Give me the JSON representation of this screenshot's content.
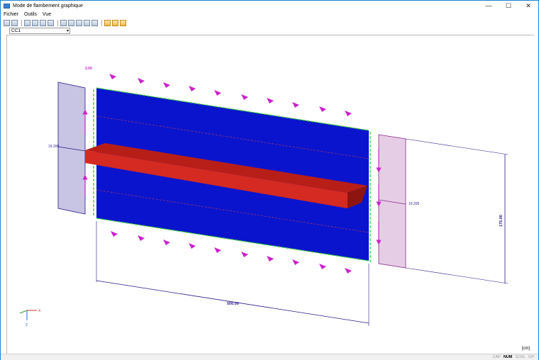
{
  "window": {
    "title": "Mode de flambement graphique",
    "buttons": {
      "minimize": "—",
      "maximize": "☐",
      "close": "✕"
    }
  },
  "menu": [
    "Fichier",
    "Outils",
    "Vue"
  ],
  "toolbar": {
    "count_left": 3,
    "count_mid": 5,
    "count_right": 2
  },
  "load_case": {
    "selected": "CC1"
  },
  "drawing": {
    "label_top_left": "2.00",
    "stress_left": "19.200",
    "stress_right": "19.200",
    "dim_length": "500.00",
    "dim_height": "175.00",
    "units": "[cm]",
    "axes": {
      "x": "X",
      "z": "Z"
    },
    "colors": {
      "panel": "#0a14cc",
      "stiffener": "#d42a22",
      "supports": "#2fd02f",
      "loads": "#cc22cc",
      "stress": "#2a1a8a"
    }
  },
  "status": [
    "CAP",
    "NUM",
    "SCRL",
    "GP"
  ]
}
